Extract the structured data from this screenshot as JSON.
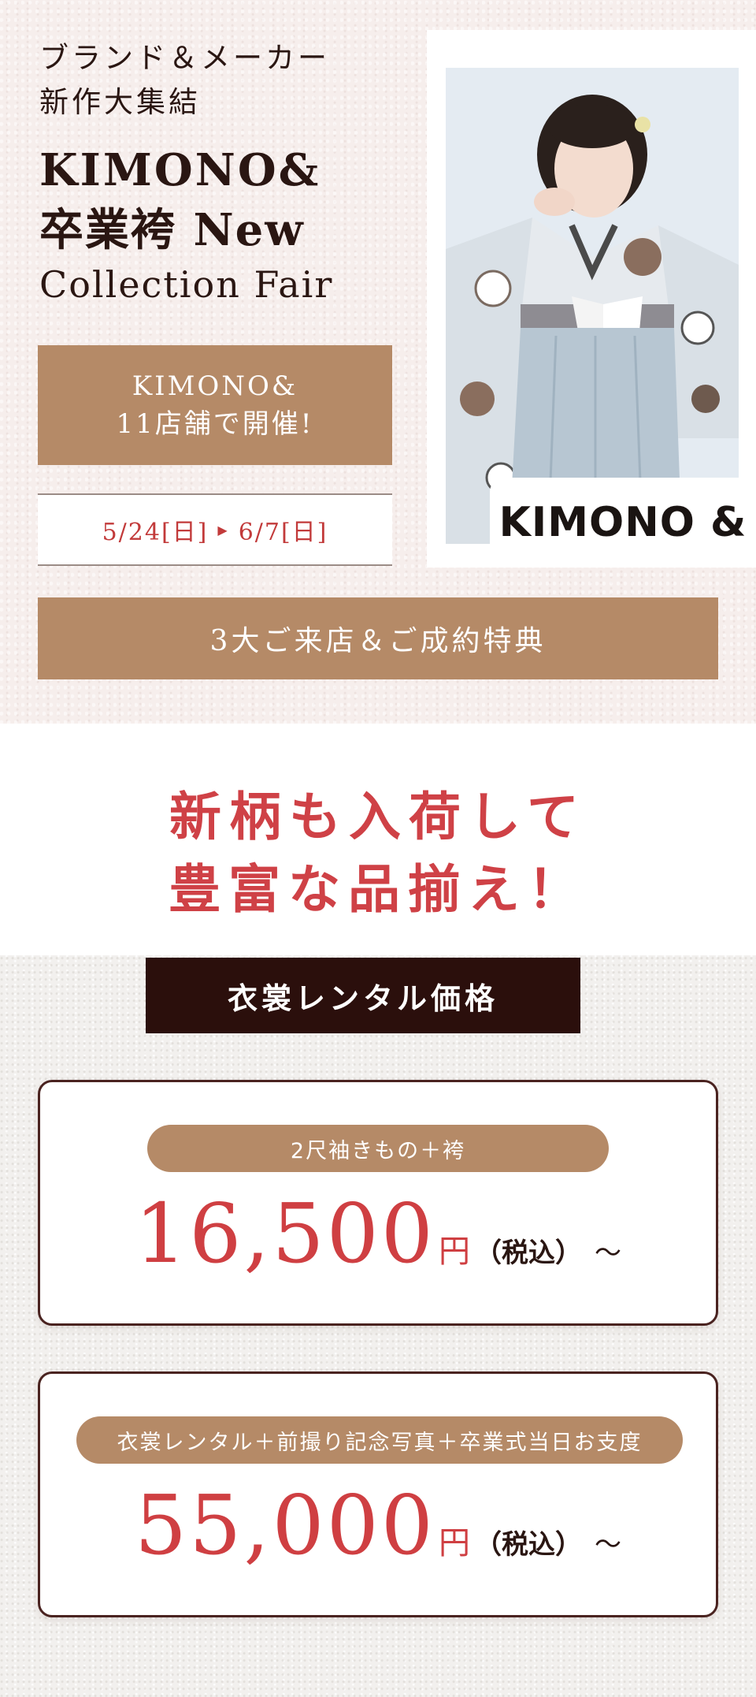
{
  "hero": {
    "lead": [
      "ブランド＆メーカー",
      "新作大集結"
    ],
    "title": {
      "line1": "KIMONO&",
      "line2": "卒業袴 New",
      "line3": "Collection Fair"
    },
    "stores": [
      "KIMONO&",
      "11店舗で開催!"
    ],
    "date": {
      "start": "5/24[日]",
      "arrow": "▶",
      "end": "6/7[日]"
    },
    "brand_tag": "KIMONO &",
    "benefit_bar": "3大ご来店＆ご成約特典"
  },
  "headline": [
    "新柄も入荷して",
    "豊富な品揃え！"
  ],
  "prices": {
    "section_label": "衣裳レンタル価格",
    "plans": [
      {
        "label": "2尺袖きもの＋袴",
        "amount": "16,500",
        "yen": "円",
        "tax": "（税込）",
        "from": "〜"
      },
      {
        "label": "衣裳レンタル＋前撮り記念写真＋卒業式当日お支度",
        "amount": "55,000",
        "yen": "円",
        "tax": "（税込）",
        "from": "〜"
      }
    ]
  },
  "colors": {
    "brown": "#b58a67",
    "dark_brown": "#2b0f0c",
    "accent_red": "#cf3f42",
    "hero_bg": "#f6eeec"
  }
}
